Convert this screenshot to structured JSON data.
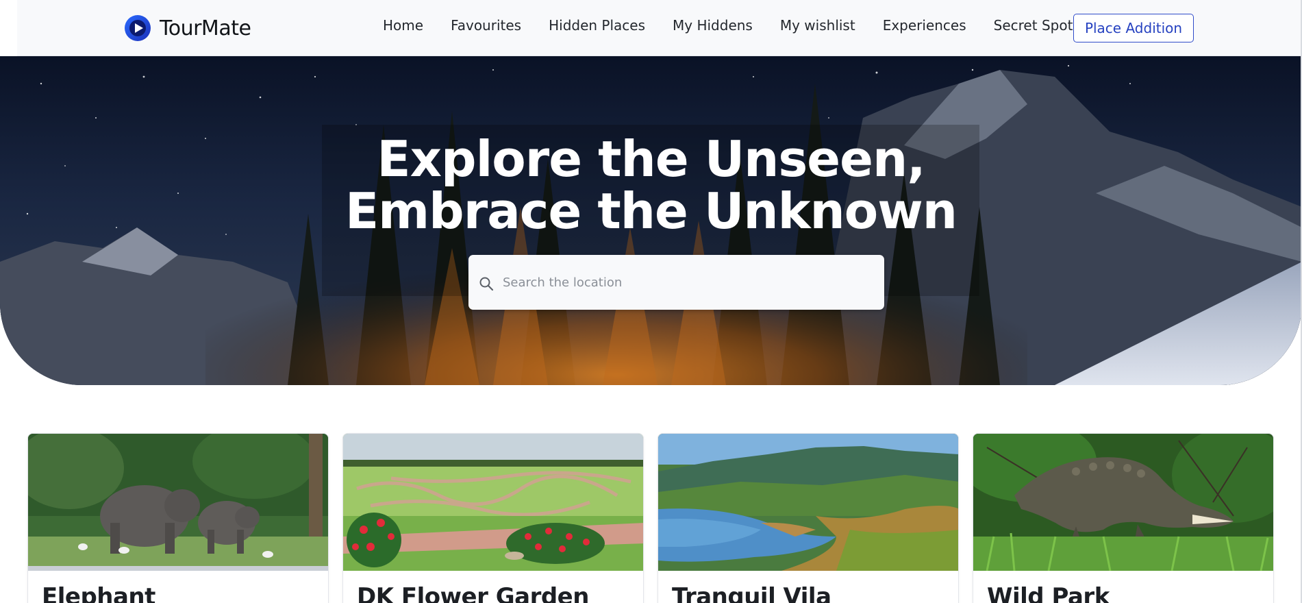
{
  "app": {
    "name": "TourMate",
    "logo_icon": "play-circle-icon",
    "brand_color": "#1f4fe0"
  },
  "nav": {
    "links": [
      {
        "label": "Home"
      },
      {
        "label": "Favourites"
      },
      {
        "label": "Hidden Places"
      },
      {
        "label": "My Hiddens"
      },
      {
        "label": "My wishlist"
      },
      {
        "label": "Experiences"
      },
      {
        "label": "Secret Spots Map"
      }
    ],
    "cta_label": "Place Addition",
    "cta_color": "#2f4bc9"
  },
  "hero": {
    "title_line1": "Explore the Unseen,",
    "title_line2": "Embrace the Unknown",
    "search": {
      "placeholder": "Search the location",
      "value": "",
      "icon": "search-icon"
    }
  },
  "places": [
    {
      "title": "Elephant",
      "image": "elephants-image"
    },
    {
      "title": "DK Flower Garden",
      "image": "flower-garden-image"
    },
    {
      "title": "Tranquil Vila",
      "image": "lake-valley-image"
    },
    {
      "title": "Wild Park",
      "image": "crocodile-image"
    }
  ]
}
